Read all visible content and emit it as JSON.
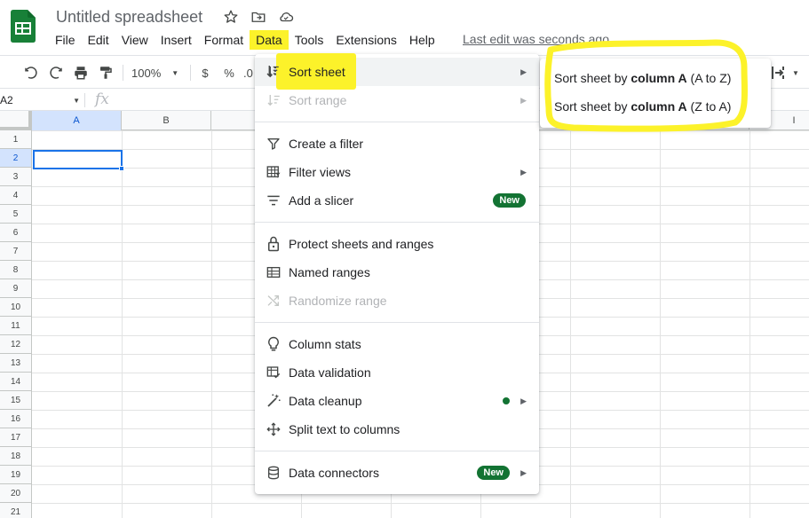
{
  "app": {
    "title": "Untitled spreadsheet",
    "last_edit": "Last edit was seconds ago"
  },
  "menubar": {
    "items": [
      "File",
      "Edit",
      "View",
      "Insert",
      "Format",
      "Data",
      "Tools",
      "Extensions",
      "Help"
    ],
    "active": "Data"
  },
  "toolbar": {
    "zoom": "100%",
    "currency": "$",
    "percent": "%",
    "decimal": ".0"
  },
  "formula_bar": {
    "cell_ref": "A2",
    "fx": "fx"
  },
  "grid": {
    "columns": [
      "A",
      "B",
      "",
      "",
      "",
      "",
      "",
      "",
      "I"
    ],
    "rows": [
      "1",
      "2",
      "3",
      "4",
      "5",
      "6",
      "7",
      "8",
      "9",
      "10",
      "11",
      "12",
      "13",
      "14",
      "15",
      "16",
      "17",
      "18",
      "19",
      "20",
      "21"
    ],
    "selected_cell": "A2"
  },
  "data_menu": {
    "items": [
      {
        "label": "Sort sheet",
        "icon": "sort-icon",
        "submenu": true,
        "disabled": false
      },
      {
        "label": "Sort range",
        "icon": "sort-icon",
        "submenu": true,
        "disabled": true
      },
      {
        "label": "Create a filter",
        "icon": "filter-icon",
        "submenu": false,
        "disabled": false
      },
      {
        "label": "Filter views",
        "icon": "filter-views-icon",
        "submenu": true,
        "disabled": false
      },
      {
        "label": "Add a slicer",
        "icon": "slicer-icon",
        "submenu": false,
        "disabled": false,
        "badge": "New"
      },
      {
        "label": "Protect sheets and ranges",
        "icon": "lock-icon",
        "submenu": false,
        "disabled": false
      },
      {
        "label": "Named ranges",
        "icon": "named-ranges-icon",
        "submenu": false,
        "disabled": false
      },
      {
        "label": "Randomize range",
        "icon": "shuffle-icon",
        "submenu": false,
        "disabled": true
      },
      {
        "label": "Column stats",
        "icon": "lightbulb-icon",
        "submenu": false,
        "disabled": false
      },
      {
        "label": "Data validation",
        "icon": "validation-icon",
        "submenu": false,
        "disabled": false
      },
      {
        "label": "Data cleanup",
        "icon": "cleanup-icon",
        "submenu": true,
        "disabled": false
      },
      {
        "label": "Split text to columns",
        "icon": "split-icon",
        "submenu": false,
        "disabled": false
      },
      {
        "label": "Data connectors",
        "icon": "database-icon",
        "submenu": true,
        "disabled": false,
        "badge": "New"
      }
    ]
  },
  "sort_submenu": {
    "az_prefix": "Sort sheet by ",
    "az_bold": "column A",
    "az_suffix": " (A to Z)",
    "za_prefix": "Sort sheet by ",
    "za_bold": "column A",
    "za_suffix": " (Z to A)"
  },
  "colors": {
    "highlight": "#fcf22a",
    "badge_green": "#137333",
    "selection_blue": "#1a73e8",
    "sheets_green": "#188038"
  }
}
